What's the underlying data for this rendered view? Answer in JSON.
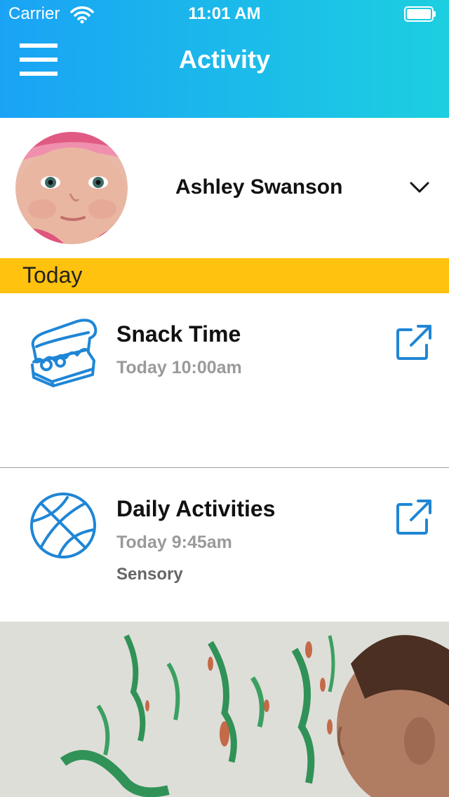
{
  "status_bar": {
    "carrier": "Carrier",
    "time": "11:01 AM"
  },
  "header": {
    "title": "Activity",
    "gradient_start": "#1aa3f5",
    "gradient_end": "#1ccfe0"
  },
  "profile": {
    "name": "Ashley Swanson"
  },
  "section": {
    "label": "Today",
    "color": "#ffc20e"
  },
  "activities": [
    {
      "title": "Snack Time",
      "time": "Today 10:00am",
      "icon": "sandwich-icon"
    },
    {
      "title": "Daily Activities",
      "time": "Today 9:45am",
      "tag": "Sensory",
      "icon": "basketball-icon"
    }
  ],
  "icon_color": "#1f86d6"
}
